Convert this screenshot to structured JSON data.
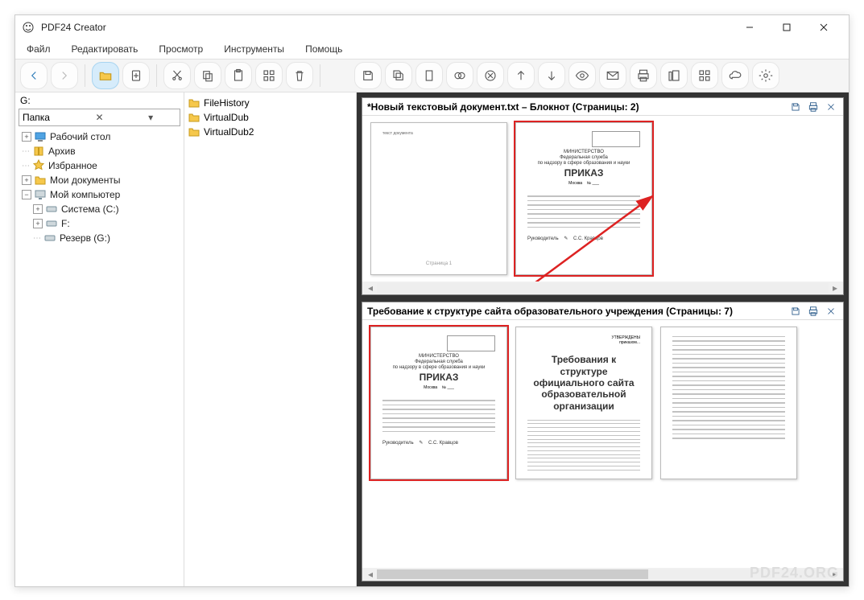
{
  "title": "PDF24 Creator",
  "menu": {
    "file": "Файл",
    "edit": "Редактировать",
    "view": "Просмотр",
    "tools": "Инструменты",
    "help": "Помощь"
  },
  "drive_label": "G:",
  "combo_label": "Папка",
  "tree": {
    "desktop": "Рабочий стол",
    "archive": "Архив",
    "favorites": "Избранное",
    "mydocs": "Мои документы",
    "mycomp": "Мой компьютер",
    "sys": "Система (C:)",
    "f": "F:",
    "reserve": "Резерв (G:)"
  },
  "files": [
    "FileHistory",
    "VirtualDub",
    "VirtualDub2"
  ],
  "doc1": {
    "title": "*Новый текстовый документ.txt – Блокнот (Страницы: 2)"
  },
  "doc2": {
    "title": "Требование к структуре сайта образовательного учреждения (Страницы: 7)"
  },
  "watermark": "PDF24.ORG"
}
